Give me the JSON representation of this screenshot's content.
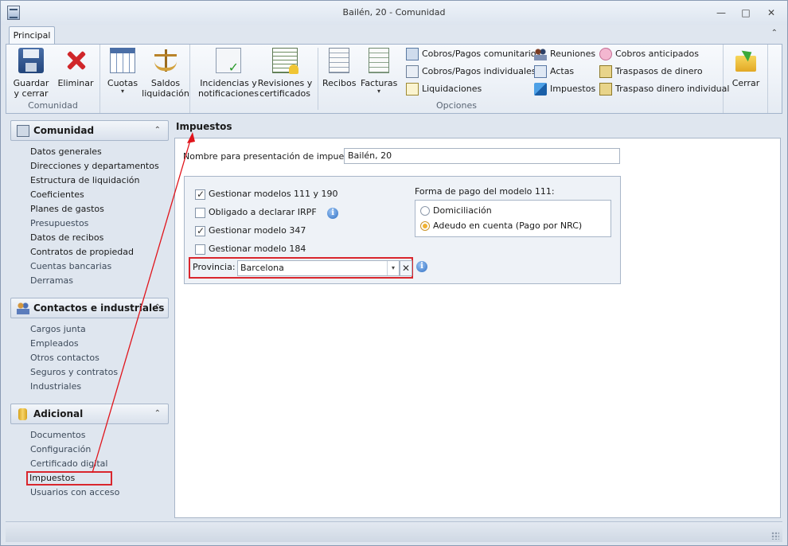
{
  "window": {
    "title": "Bailén, 20 - Comunidad",
    "minimize_glyph": "—",
    "restore_glyph": "□",
    "close_glyph": "✕"
  },
  "ribbon": {
    "tab": "Principal",
    "collapse_glyph": "⌃",
    "groups": {
      "comunidad": "Comunidad",
      "opciones": "Opciones"
    },
    "buttons": {
      "save_close": [
        "Guardar",
        "y cerrar"
      ],
      "delete": "Eliminar",
      "cuotas": "Cuotas",
      "saldos": [
        "Saldos",
        "liquidación"
      ],
      "incidencias": [
        "Incidencias y",
        "notificaciones"
      ],
      "revisiones": [
        "Revisiones y",
        "certificados"
      ],
      "recibos": "Recibos",
      "facturas": "Facturas",
      "cobros_comunitarios": "Cobros/Pagos comunitarios",
      "cobros_individuales": "Cobros/Pagos individuales",
      "liquidaciones": "Liquidaciones",
      "reuniones": "Reuniones",
      "actas": "Actas",
      "impuestos": "Impuestos",
      "cobros_anticipados": "Cobros anticipados",
      "traspasos": "Traspasos de dinero",
      "traspaso_individual": "Traspaso dinero individual",
      "cerrar": "Cerrar"
    },
    "dropdown_caret": "▾"
  },
  "nav": {
    "chevron": "⌃",
    "groups": [
      {
        "title": "Comunidad",
        "items": [
          "Datos generales",
          "Direcciones y departamentos",
          "Estructura de liquidación",
          "Coeficientes",
          "Planes de gastos",
          "Presupuestos",
          "Datos de recibos",
          "Contratos de propiedad",
          "Cuentas bancarias",
          "Derramas"
        ]
      },
      {
        "title": "Contactos e industriales",
        "items": [
          "Cargos junta",
          "Empleados",
          "Otros contactos",
          "Seguros y contratos",
          "Industriales"
        ]
      },
      {
        "title": "Adicional",
        "items": [
          "Documentos",
          "Configuración",
          "Certificado digital",
          "Impuestos",
          "Usuarios con acceso"
        ]
      }
    ],
    "selected": "Impuestos"
  },
  "content": {
    "header": "Impuestos",
    "nombre_label": "Nombre para presentación de impuestos:",
    "nombre_value": "Bailén, 20",
    "checks": [
      {
        "label": "Gestionar modelos 111 y 190",
        "checked": true
      },
      {
        "label": "Obligado a declarar IRPF",
        "checked": false
      },
      {
        "label": "Gestionar modelo 347",
        "checked": true
      },
      {
        "label": "Gestionar modelo 184",
        "checked": false
      }
    ],
    "forma_pago_label": "Forma de pago del modelo 111:",
    "radios": [
      {
        "label": "Domiciliación",
        "selected": false
      },
      {
        "label": "Adeudo en cuenta (Pago por NRC)",
        "selected": true
      }
    ],
    "provincia_label": "Provincia:",
    "provincia_value": "Barcelona",
    "info_glyph": "i",
    "combo_arrow": "▾",
    "clear_glyph": "✕"
  },
  "colors": {
    "highlight": "#d9262d",
    "accent": "#4a6ea6"
  }
}
